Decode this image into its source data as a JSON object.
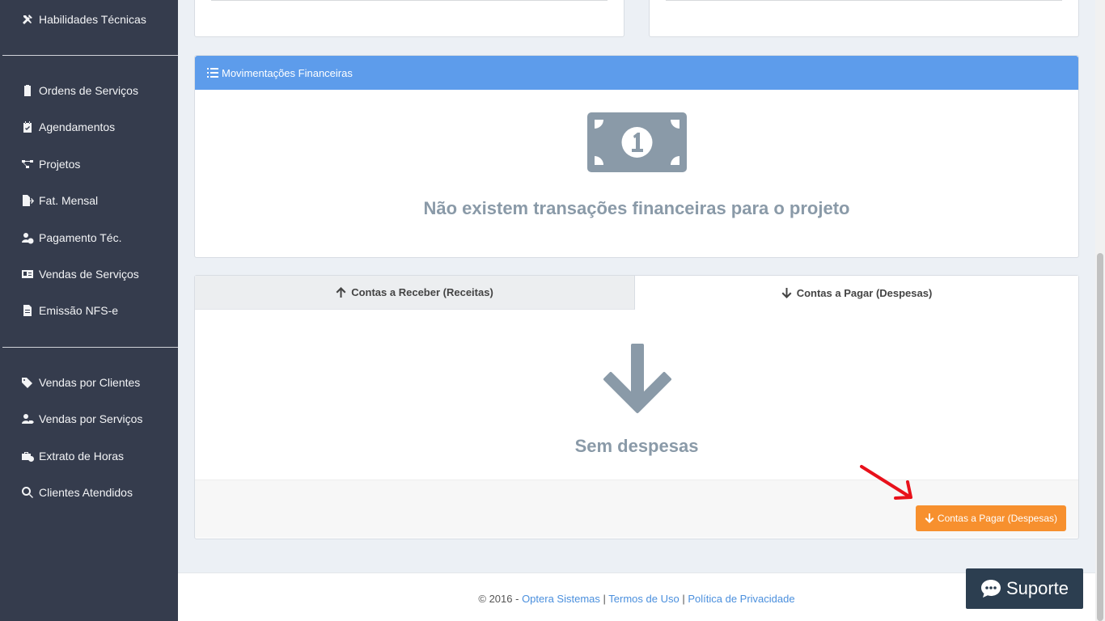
{
  "sidebar": {
    "items": [
      {
        "label": "Habilidades Técnicas",
        "icon": "tools-icon"
      },
      {
        "label": "Ordens de Serviços",
        "icon": "clipboard-icon"
      },
      {
        "label": "Agendamentos",
        "icon": "calendar-check-icon"
      },
      {
        "label": "Projetos",
        "icon": "project-diagram-icon"
      },
      {
        "label": "Fat. Mensal",
        "icon": "file-export-icon"
      },
      {
        "label": "Pagamento Téc.",
        "icon": "user-clock-icon"
      },
      {
        "label": "Vendas de Serviços",
        "icon": "id-card-icon"
      },
      {
        "label": "Emissão NFS-e",
        "icon": "file-alt-icon"
      },
      {
        "label": "Vendas por Clientes",
        "icon": "tags-icon"
      },
      {
        "label": "Vendas por Serviços",
        "icon": "user-tag-icon"
      },
      {
        "label": "Extrato de Horas",
        "icon": "briefcase-clock-icon"
      },
      {
        "label": "Clientes Atendidos",
        "icon": "search-icon"
      }
    ]
  },
  "financial_panel": {
    "title": "Movimentações Financeiras",
    "empty_message": "Não existem transações financeiras para o projeto",
    "icon": "money-bill-icon"
  },
  "tabs": {
    "receivable_label": "Contas a Receber (Receitas)",
    "payable_label": "Contas a Pagar (Despesas)",
    "empty_message": "Sem despesas",
    "action_button": "Contas a Pagar (Despesas)"
  },
  "footer": {
    "copyright": "© 2016 -",
    "company_link": "Optera Sistemas",
    "separator": "|",
    "terms_link": "Termos de Uso",
    "privacy_link": "Política de Privacidade"
  },
  "support_button": {
    "label": "Suporte",
    "icon": "comment-dots-icon"
  },
  "colors": {
    "sidebar_bg": "#353c4d",
    "panel_header": "#5d9ceb",
    "action_orange": "#f7902e",
    "support_bg": "#2c3e50",
    "annotation_red": "#e8111b"
  }
}
